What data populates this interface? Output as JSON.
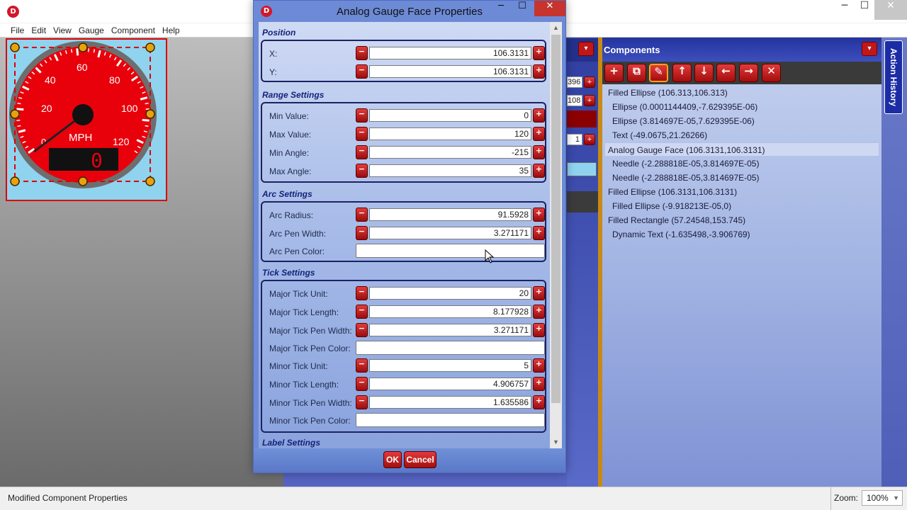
{
  "app": {
    "menu": [
      "File",
      "Edit",
      "View",
      "Gauge",
      "Component",
      "Help"
    ],
    "window_controls": [
      "─",
      "☐",
      "✕"
    ]
  },
  "gauge_preview": {
    "tick_labels": [
      "20",
      "40",
      "60",
      "80",
      "100",
      "120"
    ],
    "low_label": "0",
    "unit": "MPH",
    "digital_readout": "0",
    "colors": {
      "face": "#e8000b",
      "background": "#8fd3ef",
      "bezel": "#6e6e6e"
    }
  },
  "mid_fields": {
    "f1": "396",
    "f2": "108",
    "f3": "1"
  },
  "dialog": {
    "title": "Analog Gauge Face Properties",
    "controls": [
      "─",
      "☐",
      "✕"
    ],
    "sections": {
      "position": {
        "title": "Position",
        "x_label": "X:",
        "x_value": "106.3131",
        "y_label": "Y:",
        "y_value": "106.3131"
      },
      "range": {
        "title": "Range Settings",
        "min_value_label": "Min Value:",
        "min_value": "0",
        "max_value_label": "Max Value:",
        "max_value": "120",
        "min_angle_label": "Min Angle:",
        "min_angle": "-215",
        "max_angle_label": "Max Angle:",
        "max_angle": "35"
      },
      "arc": {
        "title": "Arc Settings",
        "radius_label": "Arc Radius:",
        "radius": "91.5928",
        "pen_width_label": "Arc Pen Width:",
        "pen_width": "3.271171",
        "pen_color_label": "Arc Pen Color:"
      },
      "tick": {
        "title": "Tick Settings",
        "major_unit_label": "Major Tick Unit:",
        "major_unit": "20",
        "major_length_label": "Major Tick Length:",
        "major_length": "8.177928",
        "major_pen_width_label": "Major Tick Pen Width:",
        "major_pen_width": "3.271171",
        "major_pen_color_label": "Major Tick Pen Color:",
        "minor_unit_label": "Minor Tick Unit:",
        "minor_unit": "5",
        "minor_length_label": "Minor Tick Length:",
        "minor_length": "4.906757",
        "minor_pen_width_label": "Minor Tick Pen Width:",
        "minor_pen_width": "1.635586",
        "minor_pen_color_label": "Minor Tick Pen Color:"
      },
      "label": {
        "title": "Label Settings"
      }
    },
    "ok_label": "OK",
    "cancel_label": "Cancel",
    "minus_glyph": "−",
    "plus_glyph": "+"
  },
  "components": {
    "title": "Components",
    "toolbar": [
      "+",
      "⧉",
      "✎",
      "↑",
      "↓",
      "←",
      "→",
      "✕"
    ],
    "items": [
      "Filled Ellipse (106.313,106.313)",
      "Ellipse (0.0001144409,-7.629395E-06)",
      "Ellipse (3.814697E-05,7.629395E-06)",
      "Text (-49.0675,21.26266)",
      "Analog Gauge Face (106.3131,106.3131)",
      "Needle (-2.288818E-05,3.814697E-05)",
      "Needle (-2.288818E-05,3.814697E-05)",
      "Filled Ellipse (106.3131,106.3131)",
      "Filled Ellipse (-9.918213E-05,0)",
      "Filled Rectangle (57.24548,153.745)",
      "Dynamic Text (-1.635498,-3.906769)"
    ]
  },
  "action_history": "Action History",
  "status": {
    "message": "Modified Component Properties",
    "zoom_label": "Zoom:",
    "zoom_value": "100%"
  }
}
